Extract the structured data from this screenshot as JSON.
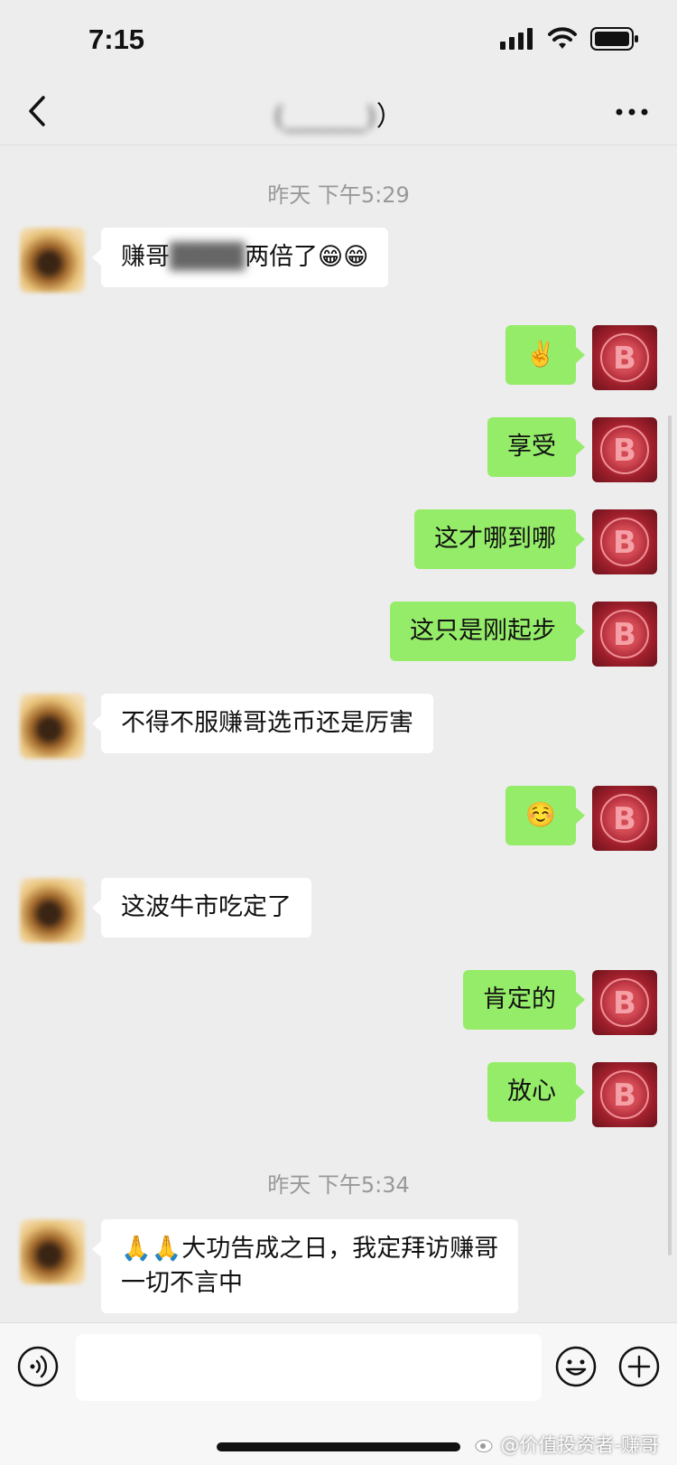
{
  "status_bar": {
    "time": "7:15"
  },
  "nav": {
    "title": "(______)",
    "title_suffix": "）"
  },
  "messages": [
    {
      "type": "timestamp",
      "text": "昨天 下午5:29"
    },
    {
      "type": "in",
      "text_a": "赚哥",
      "text_blur": "████",
      "text_b": "两倍了😁😁"
    },
    {
      "type": "out",
      "text": "✌️"
    },
    {
      "type": "out",
      "text": "享受"
    },
    {
      "type": "out",
      "text": "这才哪到哪"
    },
    {
      "type": "out",
      "text": "这只是刚起步"
    },
    {
      "type": "in",
      "text": "不得不服赚哥选币还是厉害"
    },
    {
      "type": "out",
      "text": "☺️"
    },
    {
      "type": "in",
      "text": "这波牛市吃定了"
    },
    {
      "type": "out",
      "text": "肯定的"
    },
    {
      "type": "out",
      "text": "放心"
    },
    {
      "type": "timestamp",
      "text": "昨天 下午5:34"
    },
    {
      "type": "in",
      "text": "🙏🙏大功告成之日，我定拜访赚哥\n一切不言中"
    }
  ],
  "input": {
    "placeholder": ""
  },
  "watermark": {
    "text": "@价值投资者-赚哥"
  },
  "colors": {
    "outgoing_bubble": "#95ec69",
    "incoming_bubble": "#ffffff",
    "background": "#ededed"
  },
  "icons": {
    "back": "chevron-left-icon",
    "more": "more-dots-icon",
    "voice": "voice-icon",
    "emoji": "emoji-icon",
    "plus": "plus-icon",
    "avatar_right": "bitcoin-avatar"
  }
}
